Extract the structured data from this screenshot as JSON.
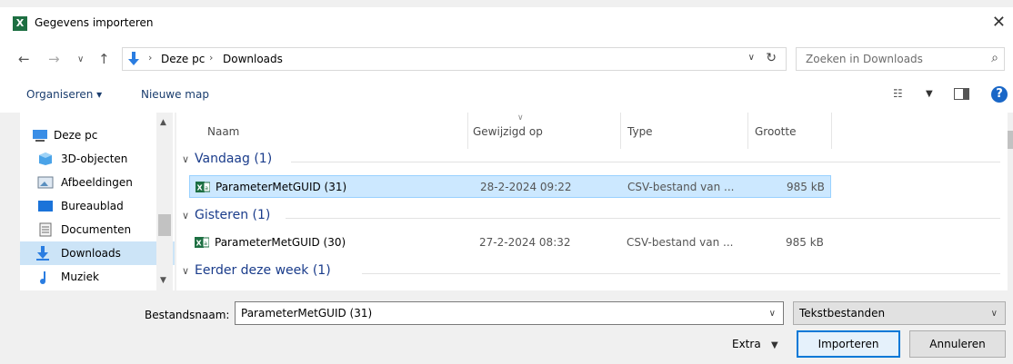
{
  "window": {
    "title": "Gegevens importeren",
    "app_icon_letter": "X",
    "close_glyph": "✕"
  },
  "nav": {
    "back": "←",
    "forward": "→",
    "recent": "∨",
    "up": "↑"
  },
  "address": {
    "crumbs": [
      "Deze pc",
      "Downloads"
    ],
    "separator": "›"
  },
  "search": {
    "placeholder": "Zoeken in Downloads"
  },
  "toolbar": {
    "organize_label": "Organiseren ▾",
    "new_folder_label": "Nieuwe map",
    "help_glyph": "?"
  },
  "sidebar": {
    "items": [
      {
        "label": "Deze pc",
        "icon": "computer-icon"
      },
      {
        "label": "3D-objecten",
        "icon": "cube-icon"
      },
      {
        "label": "Afbeeldingen",
        "icon": "pictures-icon"
      },
      {
        "label": "Bureaublad",
        "icon": "desktop-icon"
      },
      {
        "label": "Documenten",
        "icon": "documents-icon"
      },
      {
        "label": "Downloads",
        "icon": "download-icon"
      },
      {
        "label": "Muziek",
        "icon": "music-icon"
      }
    ]
  },
  "columns": [
    "Naam",
    "Gewijzigd op",
    "Type",
    "Grootte"
  ],
  "groups": [
    {
      "label": "Vandaag (1)"
    },
    {
      "label": "Gisteren (1)"
    },
    {
      "label": "Eerder deze week (1)"
    }
  ],
  "files": [
    {
      "name": "ParameterMetGUID (31)",
      "modified": "28-2-2024 09:22",
      "type": "CSV-bestand van ...",
      "size": "985 kB",
      "selected": true
    },
    {
      "name": "ParameterMetGUID (30)",
      "modified": "27-2-2024 08:32",
      "type": "CSV-bestand van ...",
      "size": "985 kB",
      "selected": false
    }
  ],
  "footer": {
    "filename_label": "Bestandsnaam:",
    "filename_value": "ParameterMetGUID (31)",
    "filter_value": "Tekstbestanden",
    "extra_label": "Extra",
    "import_label": "Importeren",
    "cancel_label": "Annuleren"
  },
  "colors": {
    "selection": "#cce8ff",
    "accent": "#0078d7",
    "group_text": "#1a3c8b"
  }
}
